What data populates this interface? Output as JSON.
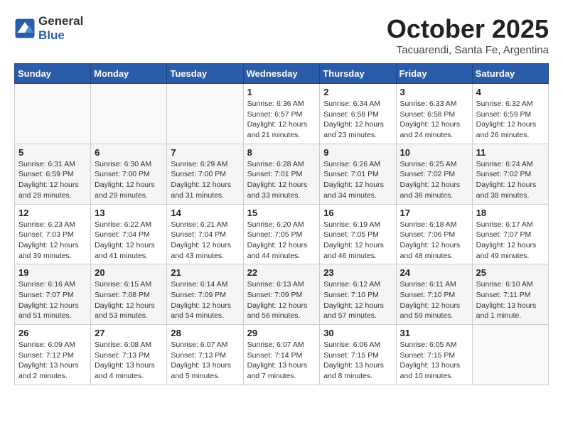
{
  "header": {
    "logo_general": "General",
    "logo_blue": "Blue",
    "month_title": "October 2025",
    "subtitle": "Tacuarendi, Santa Fe, Argentina"
  },
  "days_of_week": [
    "Sunday",
    "Monday",
    "Tuesday",
    "Wednesday",
    "Thursday",
    "Friday",
    "Saturday"
  ],
  "weeks": [
    [
      {
        "day": "",
        "info": ""
      },
      {
        "day": "",
        "info": ""
      },
      {
        "day": "",
        "info": ""
      },
      {
        "day": "1",
        "info": "Sunrise: 6:36 AM\nSunset: 6:57 PM\nDaylight: 12 hours and 21 minutes."
      },
      {
        "day": "2",
        "info": "Sunrise: 6:34 AM\nSunset: 6:58 PM\nDaylight: 12 hours and 23 minutes."
      },
      {
        "day": "3",
        "info": "Sunrise: 6:33 AM\nSunset: 6:58 PM\nDaylight: 12 hours and 24 minutes."
      },
      {
        "day": "4",
        "info": "Sunrise: 6:32 AM\nSunset: 6:59 PM\nDaylight: 12 hours and 26 minutes."
      }
    ],
    [
      {
        "day": "5",
        "info": "Sunrise: 6:31 AM\nSunset: 6:59 PM\nDaylight: 12 hours and 28 minutes."
      },
      {
        "day": "6",
        "info": "Sunrise: 6:30 AM\nSunset: 7:00 PM\nDaylight: 12 hours and 29 minutes."
      },
      {
        "day": "7",
        "info": "Sunrise: 6:29 AM\nSunset: 7:00 PM\nDaylight: 12 hours and 31 minutes."
      },
      {
        "day": "8",
        "info": "Sunrise: 6:28 AM\nSunset: 7:01 PM\nDaylight: 12 hours and 33 minutes."
      },
      {
        "day": "9",
        "info": "Sunrise: 6:26 AM\nSunset: 7:01 PM\nDaylight: 12 hours and 34 minutes."
      },
      {
        "day": "10",
        "info": "Sunrise: 6:25 AM\nSunset: 7:02 PM\nDaylight: 12 hours and 36 minutes."
      },
      {
        "day": "11",
        "info": "Sunrise: 6:24 AM\nSunset: 7:02 PM\nDaylight: 12 hours and 38 minutes."
      }
    ],
    [
      {
        "day": "12",
        "info": "Sunrise: 6:23 AM\nSunset: 7:03 PM\nDaylight: 12 hours and 39 minutes."
      },
      {
        "day": "13",
        "info": "Sunrise: 6:22 AM\nSunset: 7:04 PM\nDaylight: 12 hours and 41 minutes."
      },
      {
        "day": "14",
        "info": "Sunrise: 6:21 AM\nSunset: 7:04 PM\nDaylight: 12 hours and 43 minutes."
      },
      {
        "day": "15",
        "info": "Sunrise: 6:20 AM\nSunset: 7:05 PM\nDaylight: 12 hours and 44 minutes."
      },
      {
        "day": "16",
        "info": "Sunrise: 6:19 AM\nSunset: 7:05 PM\nDaylight: 12 hours and 46 minutes."
      },
      {
        "day": "17",
        "info": "Sunrise: 6:18 AM\nSunset: 7:06 PM\nDaylight: 12 hours and 48 minutes."
      },
      {
        "day": "18",
        "info": "Sunrise: 6:17 AM\nSunset: 7:07 PM\nDaylight: 12 hours and 49 minutes."
      }
    ],
    [
      {
        "day": "19",
        "info": "Sunrise: 6:16 AM\nSunset: 7:07 PM\nDaylight: 12 hours and 51 minutes."
      },
      {
        "day": "20",
        "info": "Sunrise: 6:15 AM\nSunset: 7:08 PM\nDaylight: 12 hours and 53 minutes."
      },
      {
        "day": "21",
        "info": "Sunrise: 6:14 AM\nSunset: 7:09 PM\nDaylight: 12 hours and 54 minutes."
      },
      {
        "day": "22",
        "info": "Sunrise: 6:13 AM\nSunset: 7:09 PM\nDaylight: 12 hours and 56 minutes."
      },
      {
        "day": "23",
        "info": "Sunrise: 6:12 AM\nSunset: 7:10 PM\nDaylight: 12 hours and 57 minutes."
      },
      {
        "day": "24",
        "info": "Sunrise: 6:11 AM\nSunset: 7:10 PM\nDaylight: 12 hours and 59 minutes."
      },
      {
        "day": "25",
        "info": "Sunrise: 6:10 AM\nSunset: 7:11 PM\nDaylight: 13 hours and 1 minute."
      }
    ],
    [
      {
        "day": "26",
        "info": "Sunrise: 6:09 AM\nSunset: 7:12 PM\nDaylight: 13 hours and 2 minutes."
      },
      {
        "day": "27",
        "info": "Sunrise: 6:08 AM\nSunset: 7:13 PM\nDaylight: 13 hours and 4 minutes."
      },
      {
        "day": "28",
        "info": "Sunrise: 6:07 AM\nSunset: 7:13 PM\nDaylight: 13 hours and 5 minutes."
      },
      {
        "day": "29",
        "info": "Sunrise: 6:07 AM\nSunset: 7:14 PM\nDaylight: 13 hours and 7 minutes."
      },
      {
        "day": "30",
        "info": "Sunrise: 6:06 AM\nSunset: 7:15 PM\nDaylight: 13 hours and 8 minutes."
      },
      {
        "day": "31",
        "info": "Sunrise: 6:05 AM\nSunset: 7:15 PM\nDaylight: 13 hours and 10 minutes."
      },
      {
        "day": "",
        "info": ""
      }
    ]
  ]
}
